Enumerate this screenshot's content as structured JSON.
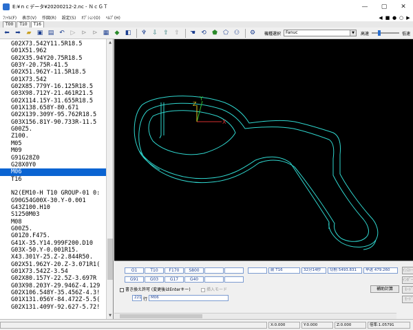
{
  "window": {
    "title": "E:¥ｎｃデータ¥20200212-2.nc - ＮｃＧＴ",
    "buttons": [
      "—",
      "▢",
      "✕"
    ]
  },
  "menu": {
    "items": [
      "ﾌｧｲﾙ(F)",
      "表示(V)",
      "作図(R)",
      "設定(S)",
      "ｵﾌﾟｼｮﾝ(O)",
      "ﾍﾙﾌﾟ(H)"
    ]
  },
  "tabs": [
    "T00",
    "T10",
    "T16"
  ],
  "toolbar": {
    "model_label": "機種選択",
    "model_value": "Fanuc",
    "speed_label": "高速",
    "speed_low": "低速",
    "speed_level": 0.25
  },
  "code": {
    "lines": [
      "G02X73.542Y11.5R18.5",
      "G01X51.962",
      "G02X35.94Y20.75R18.5",
      "G03Y-20.75R-41.5",
      "G02X51.962Y-11.5R18.5",
      "G01X73.542",
      "G02X85.779Y-16.125R18.5",
      "G03X98.712Y-21.461R21.5",
      "G02X114.15Y-31.655R18.5",
      "G01X138.658Y-80.671",
      "G02X139.309Y-95.762R18.5",
      "G03X156.81Y-90.733R-11.5",
      "G00Z5.",
      "Z100.",
      "M05",
      "M09",
      "G91G28Z0",
      "G28X0Y0",
      "M06",
      "T16",
      "",
      "N2(EM10-H T10 GROUP-01 0:",
      "G90G54G00X-30.Y-0.001",
      "G43Z100.H10",
      "S1250M03",
      "M08",
      "G00Z5.",
      "G01Z0.F475.",
      "G41X-35.Y14.999F200.D10",
      "G03X-50.Y-0.001R15.",
      "X43.301Y-25.Z-2.844R50.",
      "G02X51.962Y-20.Z-3.071R1(",
      "G01X73.542Z-3.54",
      "G02X80.157Y-22.5Z-3.697R",
      "G03X98.203Y-29.946Z-4.129",
      "G02X106.548Y-35.456Z-4.3!",
      "G01X131.056Y-84.472Z-5.5(",
      "G02X131.409Y-92.627-5.72!"
    ],
    "selected_index": 18
  },
  "bottom": {
    "row1": [
      "O1",
      "T10",
      "F170",
      "S800"
    ],
    "row2": [
      "G91",
      "G03",
      "G17",
      "G40"
    ],
    "next_tool": "前 T16",
    "time": "32分14秒",
    "cut_label": "切削 5493.831",
    "rapid_label": "早送 479.260",
    "overwrite_label": "書き換え許可 (変更後はEnterキー)",
    "insert_mode_label": "挿入モード",
    "line_no": "221",
    "line_prefix": "行",
    "line_value": "M06",
    "calc_button": "補助計算",
    "right_buttons": [
      "ｲﾝｽﾄｰﾙ",
      "ｲﾝﾎﾟｰﾄ",
      "ﾓｰﾄﾞ",
      "ﾓｰﾄﾞ"
    ]
  },
  "status": {
    "x": "X:0.000",
    "y": "Y:0.000",
    "z": "Z:0.000",
    "scale": "倍率:1.05791"
  }
}
